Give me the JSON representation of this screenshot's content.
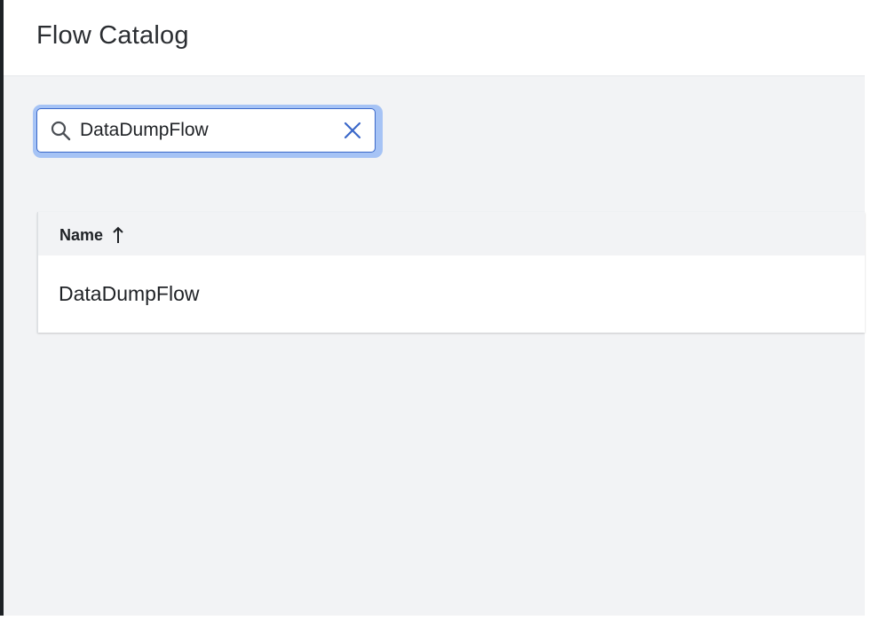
{
  "header": {
    "title": "Flow Catalog"
  },
  "search": {
    "value": "DataDumpFlow"
  },
  "table": {
    "columns": [
      {
        "label": "Name",
        "sort": "ascending"
      }
    ],
    "rows": [
      {
        "name": "DataDumpFlow"
      }
    ]
  },
  "icons": {
    "search": "search-icon",
    "clear": "close-icon",
    "sort": "arrow-up-icon"
  },
  "colors": {
    "accent": "#3b68c9",
    "focus_ring": "#a6c3f5",
    "background": "#f2f3f5"
  }
}
